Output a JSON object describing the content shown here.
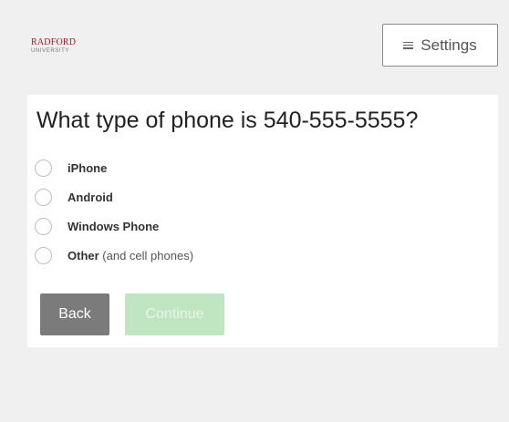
{
  "header": {
    "logo_main": "RADFORD",
    "logo_sub": "UNIVERSITY",
    "settings_label": "Settings"
  },
  "question": {
    "title": "What type of phone is 540-555-5555?",
    "options": [
      {
        "label": "iPhone",
        "note": ""
      },
      {
        "label": "Android",
        "note": ""
      },
      {
        "label": "Windows Phone",
        "note": ""
      },
      {
        "label": "Other",
        "note": "(and cell phones)"
      }
    ]
  },
  "buttons": {
    "back_label": "Back",
    "continue_label": "Continue",
    "continue_disabled": true
  },
  "colors": {
    "brand_red": "#b5121b",
    "back_button": "#7b7b7b",
    "continue_disabled": "#bfe5c1"
  }
}
